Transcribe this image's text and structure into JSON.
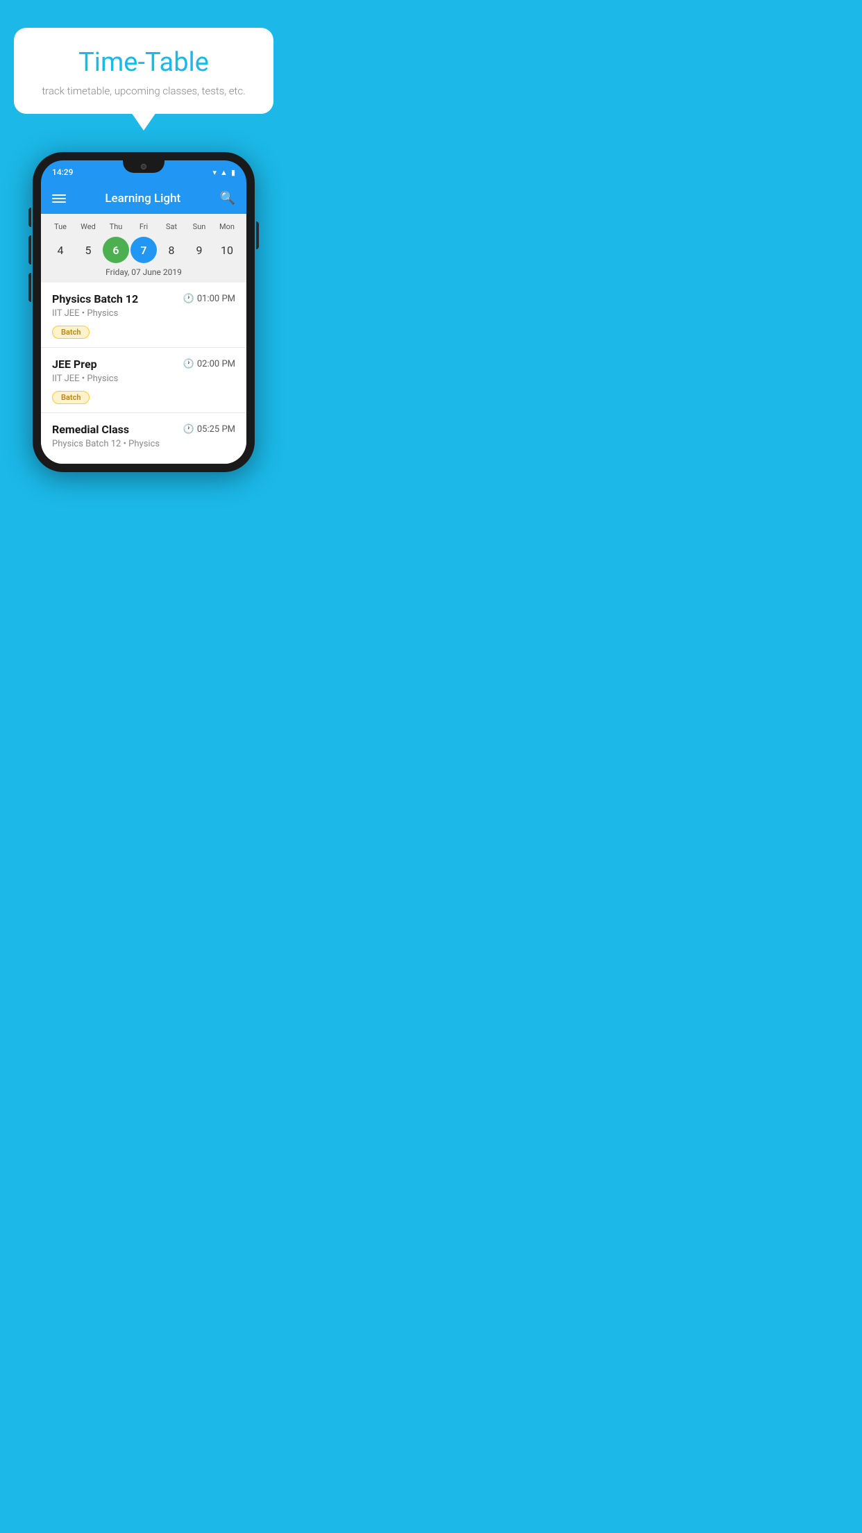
{
  "background_color": "#1BB8E8",
  "card": {
    "title": "Time-Table",
    "subtitle": "track timetable, upcoming classes, tests, etc."
  },
  "phone": {
    "time": "14:29",
    "app_title": "Learning Light",
    "calendar": {
      "days": [
        {
          "label": "Tue",
          "num": "4"
        },
        {
          "label": "Wed",
          "num": "5"
        },
        {
          "label": "Thu",
          "num": "6",
          "state": "today"
        },
        {
          "label": "Fri",
          "num": "7",
          "state": "selected"
        },
        {
          "label": "Sat",
          "num": "8"
        },
        {
          "label": "Sun",
          "num": "9"
        },
        {
          "label": "Mon",
          "num": "10"
        }
      ],
      "selected_date_label": "Friday, 07 June 2019"
    },
    "schedule": [
      {
        "title": "Physics Batch 12",
        "time": "01:00 PM",
        "subtitle": "IIT JEE • Physics",
        "badge": "Batch"
      },
      {
        "title": "JEE Prep",
        "time": "02:00 PM",
        "subtitle": "IIT JEE • Physics",
        "badge": "Batch"
      },
      {
        "title": "Remedial Class",
        "time": "05:25 PM",
        "subtitle": "Physics Batch 12 • Physics",
        "badge": null
      }
    ]
  }
}
